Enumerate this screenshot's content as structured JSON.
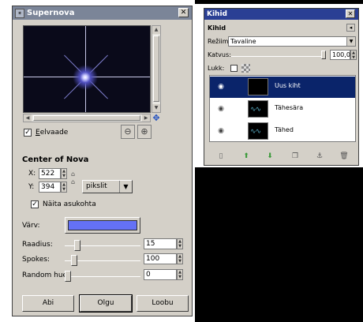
{
  "supernova": {
    "title": "Supernova",
    "close_glyph": "✕",
    "preview_label": "Eelvaade",
    "preview_checked": "✓",
    "center_title": "Center of Nova",
    "x_label": "X:",
    "x_value": "522",
    "y_label": "Y:",
    "y_value": "394",
    "unit": "pikslit",
    "show_position_label": "Näita asukohta",
    "show_position_checked": "✓",
    "color_label": "Värv:",
    "color_value": "#6471f5",
    "radius_label": "Raadius:",
    "radius_value": "15",
    "spokes_label": "Spokes:",
    "spokes_value": "100",
    "random_hue_label": "Random hue:",
    "random_hue_value": "0",
    "help_button": "Abi",
    "ok_button": "Olgu",
    "cancel_button": "Loobu"
  },
  "layers": {
    "title": "Kihid",
    "close_glyph": "✕",
    "panel_label": "Kihid",
    "mode_label": "Režiim:",
    "mode_value": "Tavaline",
    "opacity_label": "Katvus:",
    "opacity_value": "100,0",
    "lock_label": "Lukk:",
    "items": [
      {
        "name": "Uus kiht",
        "selected": true
      },
      {
        "name": "Tähesära",
        "selected": false
      },
      {
        "name": "Tähed",
        "selected": false
      }
    ]
  },
  "colors": {
    "title_bg": "#7b8598",
    "layers_title_bg": "#2a3f94",
    "selection_bg": "#0a246a",
    "dialog_bg": "#d4d0c8"
  }
}
